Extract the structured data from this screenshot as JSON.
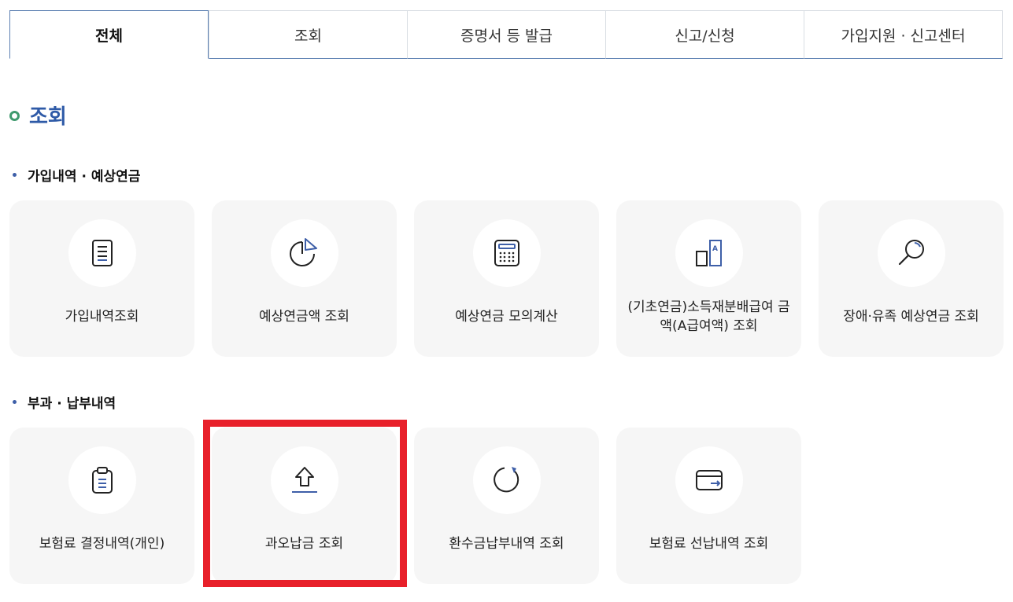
{
  "tabs": [
    {
      "label": "전체",
      "active": true
    },
    {
      "label": "조회",
      "active": false
    },
    {
      "label": "증명서 등 발급",
      "active": false
    },
    {
      "label": "신고/신청",
      "active": false
    },
    {
      "label": "가입지원 · 신고센터",
      "active": false
    }
  ],
  "section": {
    "title": "조회"
  },
  "groups": [
    {
      "title": "가입내역 · 예상연금",
      "cards": [
        {
          "label": "가입내역조회",
          "icon": "document-icon"
        },
        {
          "label": "예상연금액 조회",
          "icon": "pie-chart-icon"
        },
        {
          "label": "예상연금 모의계산",
          "icon": "calculator-icon"
        },
        {
          "label": "(기초연금)소득재분배급여 금액(A급여액) 조회",
          "icon": "a-value-icon"
        },
        {
          "label": "장애·유족 예상연금 조회",
          "icon": "magnifier-icon"
        }
      ]
    },
    {
      "title": "부과 · 납부내역",
      "cards": [
        {
          "label": "보험료 결정내역(개인)",
          "icon": "clipboard-icon"
        },
        {
          "label": "과오납금 조회",
          "icon": "upload-arrow-icon"
        },
        {
          "label": "환수금납부내역 조회",
          "icon": "refresh-icon"
        },
        {
          "label": "보험료 선납내역 조회",
          "icon": "wallet-icon"
        }
      ]
    }
  ],
  "colors": {
    "accent": "#2e5aa7",
    "highlight": "#e8202a",
    "ring": "#3f9a6e"
  }
}
